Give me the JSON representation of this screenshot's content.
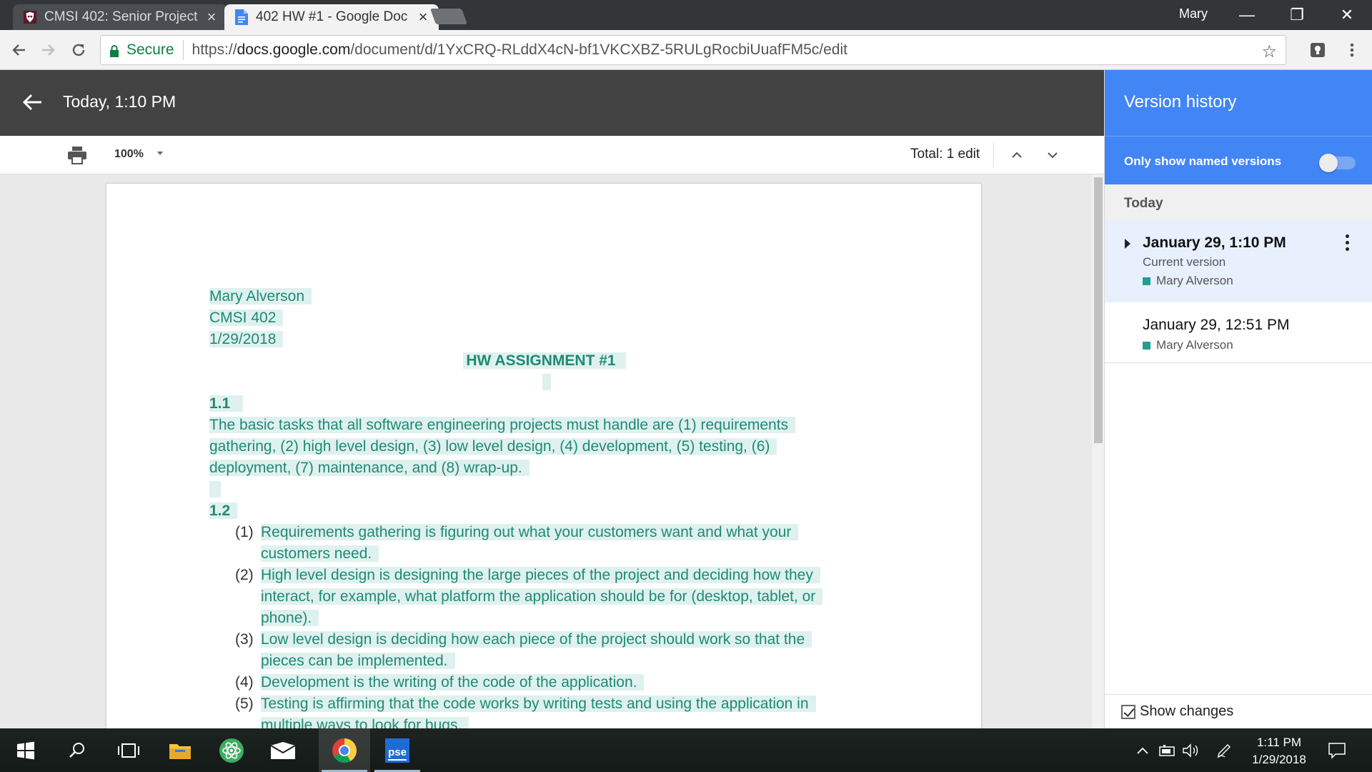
{
  "browser": {
    "tabs": [
      {
        "title": "CMSI 402: Senior Project",
        "active": false,
        "icon": "lmu-lion-icon"
      },
      {
        "title": "402 HW #1 - Google Doc",
        "active": true,
        "icon": "google-docs-icon"
      }
    ],
    "close_glyph": "×",
    "profile_name": "Mary",
    "window_controls": {
      "minimize": "—",
      "restore": "❐",
      "close": "✕"
    },
    "secure_label": "Secure",
    "url_scheme": "https://",
    "url_host": "docs.google.com",
    "url_path": "/document/d/1YxCRQ-RLddX4cN-bf1VKCXBZ-5RULgRocbiUuafFM5c/edit",
    "star_icon": "☆"
  },
  "docs": {
    "version_title": "Today, 1:10 PM",
    "zoom": "100%",
    "total_edits": "Total: 1 edit"
  },
  "document": {
    "header_lines": [
      "Mary Alverson",
      "CMSI 402",
      "1/29/2018"
    ],
    "heading": "HW ASSIGNMENT #1",
    "section_1_1": {
      "title": "1.1",
      "lines": [
        "The basic tasks that all software engineering projects must handle are (1) requirements",
        "gathering, (2) high level design, (3) low level design, (4) development, (5) testing, (6)",
        "deployment, (7) maintenance, and (8) wrap-up."
      ]
    },
    "section_1_2": {
      "title": "1.2",
      "items": [
        {
          "num": "(1)",
          "lines": [
            "Requirements gathering is figuring out what your customers want and what your",
            "customers need."
          ]
        },
        {
          "num": "(2)",
          "lines": [
            "High level design is designing the large pieces of the project and deciding how they",
            "interact, for example, what platform the application should be for (desktop, tablet, or",
            "phone)."
          ]
        },
        {
          "num": "(3)",
          "lines": [
            "Low level design is deciding how each piece of the project should work so that the",
            "pieces can be implemented."
          ]
        },
        {
          "num": "(4)",
          "lines": [
            "Development is the writing of the code of the application."
          ]
        },
        {
          "num": "(5)",
          "lines": [
            "Testing is affirming that the code works by writing tests and using the application in",
            "multiple ways to look for bugs."
          ]
        }
      ]
    }
  },
  "version_history": {
    "title": "Version history",
    "filter_label": "Only show named versions",
    "filter_enabled": false,
    "section_label": "Today",
    "versions": [
      {
        "date": "January 29, 1:10 PM",
        "subtitle": "Current version",
        "author": "Mary Alverson",
        "selected": true
      },
      {
        "date": "January 29, 12:51 PM",
        "author": "Mary Alverson",
        "selected": false
      }
    ],
    "show_changes_label": "Show changes",
    "show_changes_checked": true,
    "author_color": "#20a090"
  },
  "taskbar": {
    "apps": [
      "windows-start-icon",
      "search-icon",
      "task-view-icon",
      "file-explorer-icon",
      "atom-icon",
      "mail-icon",
      "chrome-icon",
      "phpstorm-icon"
    ],
    "pse_label": "pse",
    "clock_time": "1:11 PM",
    "clock_date": "1/29/2018"
  },
  "colors": {
    "highlight_bg": "#dff1ee",
    "highlight_text": "#1e8a75",
    "docs_header": "#424242",
    "panel_accent": "#4285f4"
  }
}
